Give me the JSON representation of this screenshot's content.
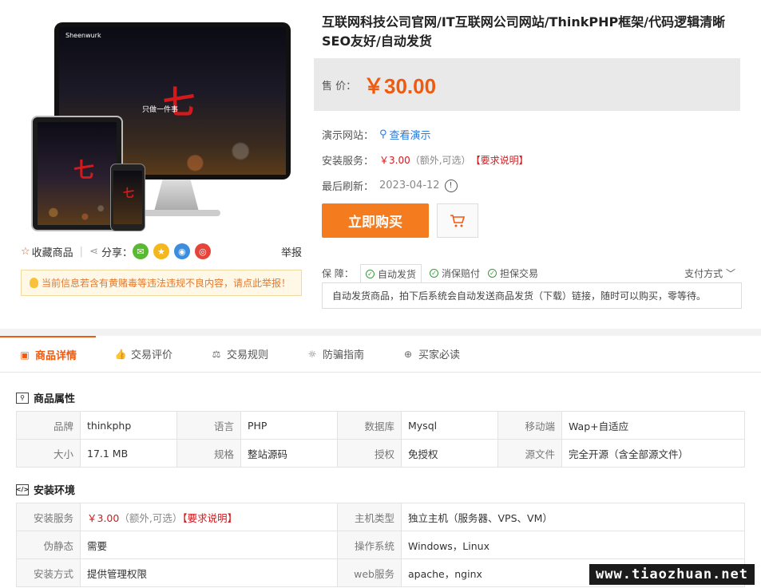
{
  "product": {
    "title": "互联网科技公司官网/IT互联网公司网站/ThinkPHP框架/代码逻辑清晰SEO友好/自动发货",
    "price_label": "售  价：",
    "price": "￥30.00",
    "demo_label": "演示网站：",
    "demo_link": "查看演示",
    "install_label": "安装服务：",
    "install_price": "￥3.00",
    "install_note": "（额外,可选）",
    "install_req": "【要求说明】",
    "refresh_label": "最后刷新：",
    "refresh_date": "2023-04-12",
    "buy_label": "立即购买",
    "guarantee_label": "保  障：",
    "guarantees": [
      "自动发货",
      "消保赔付",
      "担保交易"
    ],
    "pay_methods": "支付方式",
    "guarantee_desc": "自动发货商品，拍下后系统会自动发送商品发货（下载）链接，随时可以购买，零等待。"
  },
  "image_text": {
    "slogan": "只做一件事",
    "brand": "Sheenwurk"
  },
  "share": {
    "favorite": "收藏商品",
    "share_label": "分享：",
    "report": "举报"
  },
  "notice": "当前信息若含有黄赌毒等违法违规不良内容，请点此举报！",
  "tabs": [
    "商品详情",
    "交易评价",
    "交易规则",
    "防骗指南",
    "买家必读"
  ],
  "attributes": {
    "title": "商品属性",
    "rows": [
      [
        [
          "品牌",
          "thinkphp"
        ],
        [
          "语言",
          "PHP"
        ],
        [
          "数据库",
          "Mysql"
        ],
        [
          "移动端",
          "Wap+自适应"
        ]
      ],
      [
        [
          "大小",
          "17.1 MB"
        ],
        [
          "规格",
          "整站源码"
        ],
        [
          "授权",
          "免授权"
        ],
        [
          "源文件",
          "完全开源（含全部源文件）"
        ]
      ]
    ]
  },
  "environment": {
    "title": "安装环境",
    "install_k": "安装服务",
    "install_price": "￥3.00",
    "install_note": "（额外,可选）",
    "install_req": "【要求说明】",
    "host_k": "主机类型",
    "host_v": "独立主机（服务器、VPS、VM）",
    "static_k": "伪静态",
    "static_v": "需要",
    "os_k": "操作系统",
    "os_v": "Windows，Linux",
    "method_k": "安装方式",
    "method_v": "提供管理权限",
    "web_k": "web服务",
    "web_v": "apache，nginx"
  },
  "watermark": "www.tiaozhuan.net",
  "colors": {
    "accent": "#f05a0f",
    "buy": "#f47b1e",
    "link": "#2a7ad8",
    "red": "#d4191d"
  }
}
